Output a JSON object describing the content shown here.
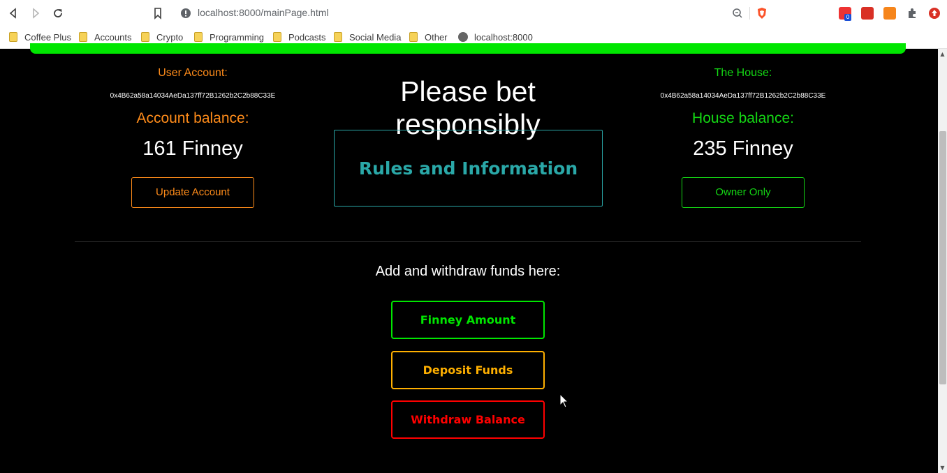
{
  "browser": {
    "url": "localhost:8000/mainPage.html",
    "extension_badge": "0",
    "bookmarks": [
      "Coffee Plus",
      "Accounts",
      "Crypto",
      "Programming",
      "Podcasts",
      "Social Media",
      "Other",
      "localhost:8000"
    ]
  },
  "user": {
    "label": "User Account:",
    "address": "0x4B62a58a14034AeDa137ff72B1262b2C2b88C33E",
    "balance_label": "Account balance:",
    "balance_value": "161 Finney",
    "button": "Update Account"
  },
  "house": {
    "label": "The House:",
    "address": "0x4B62a58a14034AeDa137ff72B1262b2C2b88C33E",
    "balance_label": "House balance:",
    "balance_value": "235 Finney",
    "button": "Owner Only"
  },
  "center": {
    "headline": "Please bet responsibly",
    "rules": "Rules and Information"
  },
  "funds": {
    "heading": "Add and withdraw funds here:",
    "amount_label": "Finney Amount",
    "deposit_label": "Deposit Funds",
    "withdraw_label": "Withdraw Balance"
  },
  "colors": {
    "user": "#ff8c1a",
    "house": "#14d714",
    "teal": "#2aa8a8",
    "amount": "#00e600",
    "deposit": "#ffb000",
    "withdraw": "#ff0000"
  }
}
